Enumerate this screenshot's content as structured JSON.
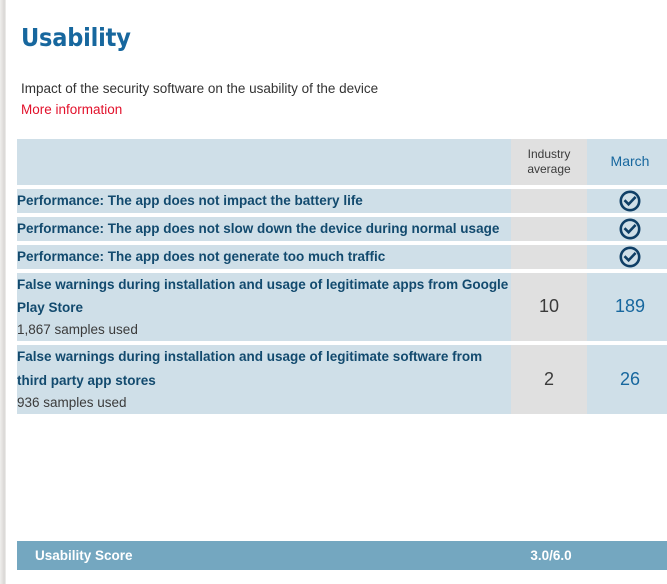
{
  "section": {
    "title": "Usability",
    "subtitle": "Impact of the security software on the usability of the device",
    "more_info_label": "More information"
  },
  "colors": {
    "title_blue": "#17679e",
    "link_red": "#e2112b",
    "row_blue": "#cfdfe8",
    "row_gray": "#e0e0e0",
    "score_bar_blue": "#74a7c0",
    "text_navy": "#124a6e"
  },
  "table": {
    "columns": [
      {
        "key": "description",
        "label": ""
      },
      {
        "key": "industry_average",
        "label": "Industry\naverage"
      },
      {
        "key": "month",
        "label": "March"
      }
    ],
    "header": {
      "description": "",
      "industry_average_line1": "Industry",
      "industry_average_line2": "average",
      "month": "March"
    },
    "rows": [
      {
        "description": "Performance: The app does not impact the battery life",
        "samples": "",
        "industry_average": "",
        "month_icon": "check-circle-icon",
        "month_value": ""
      },
      {
        "description": "Performance: The app does not slow down the device during normal usage",
        "samples": "",
        "industry_average": "",
        "month_icon": "check-circle-icon",
        "month_value": ""
      },
      {
        "description": "Performance: The app does not generate too much traffic",
        "samples": "",
        "industry_average": "",
        "month_icon": "check-circle-icon",
        "month_value": ""
      },
      {
        "description": "False warnings during installation and usage of legitimate apps from Google Play Store",
        "samples": "1,867 samples used",
        "industry_average": "10",
        "month_icon": "",
        "month_value": "189"
      },
      {
        "description": "False warnings during installation and usage of legitimate software from third party app stores",
        "samples": "936 samples used",
        "industry_average": "2",
        "month_icon": "",
        "month_value": "26"
      }
    ]
  },
  "score": {
    "label": "Usability Score",
    "value": "3.0/6.0"
  }
}
